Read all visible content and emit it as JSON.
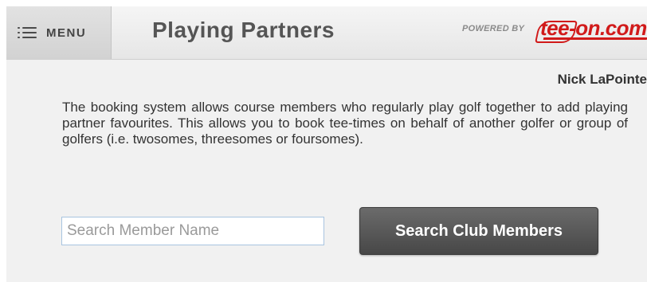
{
  "header": {
    "menu_label": "MENU",
    "title": "Playing Partners",
    "powered_by": "POWERED BY",
    "brand": "tee-on.com"
  },
  "user": {
    "name": "Nick LaPointe"
  },
  "description": "The booking system allows course members who regularly play golf together to add playing partner favourites. This allows you to book tee-times on behalf of another golfer or group of golfers (i.e. twosomes, threesomes or foursomes).",
  "search": {
    "placeholder": "Search Member Name",
    "value": "",
    "button_label": "Search Club Members"
  },
  "colors": {
    "brand_red": "#d11a1a",
    "button_dark": "#555555",
    "background": "#f1f1f1"
  },
  "icons": {
    "menu": "hamburger-icon"
  }
}
